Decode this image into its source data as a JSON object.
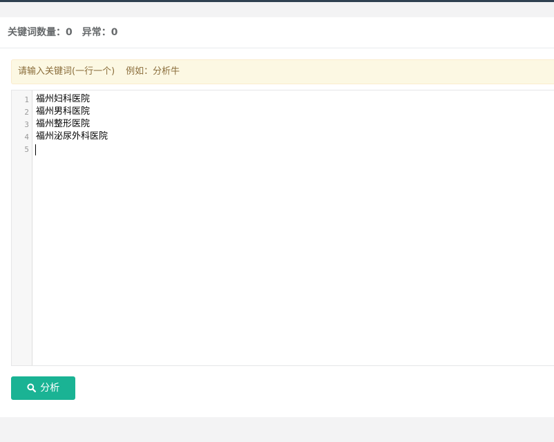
{
  "header": {
    "keyword_count_label": "关键词数量：",
    "keyword_count": "0",
    "error_label": "异常：",
    "error_count": "0"
  },
  "alert": {
    "instruction": "请输入关键词(一行一个)",
    "example": "例如：分析牛"
  },
  "editor": {
    "line_numbers": [
      "1",
      "2",
      "3",
      "4",
      "5"
    ],
    "lines": [
      "福州妇科医院",
      "福州男科医院",
      "福州整形医院",
      "福州泌尿外科医院",
      ""
    ]
  },
  "analyze_button": {
    "label": "分析",
    "icon": "search-icon"
  },
  "colors": {
    "accent": "#1ab394",
    "top_bar": "#2f4050",
    "alert_bg": "#fcf8e3",
    "alert_text": "#8a6d3b"
  }
}
